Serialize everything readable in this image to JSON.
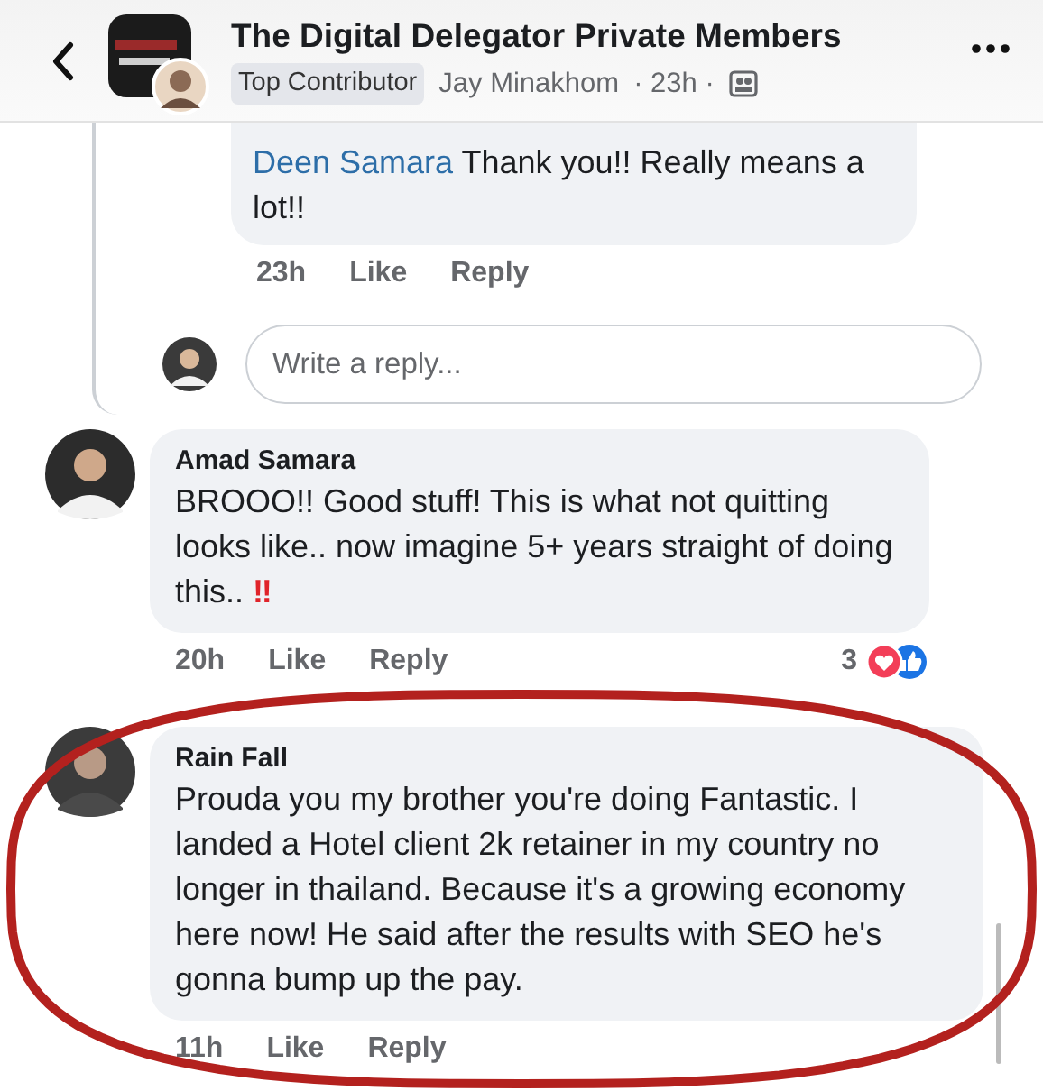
{
  "header": {
    "title": "The Digital Delegator Private Members",
    "badge": "Top Contributor",
    "author": "Jay Minakhom",
    "meta": "· 23h ·"
  },
  "reply": {
    "mention": "Deen Samara",
    "text": "Thank you!! Really means a lot!!",
    "time": "23h",
    "actions": [
      "Like",
      "Reply"
    ]
  },
  "reply_field": {
    "placeholder": "Write a reply..."
  },
  "comments": [
    {
      "author": "Amad Samara",
      "text": "BROOO!! Good stuff! This is what not quitting looks like.. now imagine 5+ years straight of doing this..",
      "emoji": "‼",
      "time": "20h",
      "actions": [
        "Like",
        "Reply"
      ],
      "reactions_count": "3"
    },
    {
      "author": "Rain Fall",
      "text": "Prouda you my brother you're doing Fantastic. I landed a Hotel client 2k retainer in my country no longer in thailand. Because it's a growing economy here now! He said after the results with SEO he's gonna bump up the pay.",
      "time": "11h",
      "actions": [
        "Like",
        "Reply"
      ]
    }
  ]
}
